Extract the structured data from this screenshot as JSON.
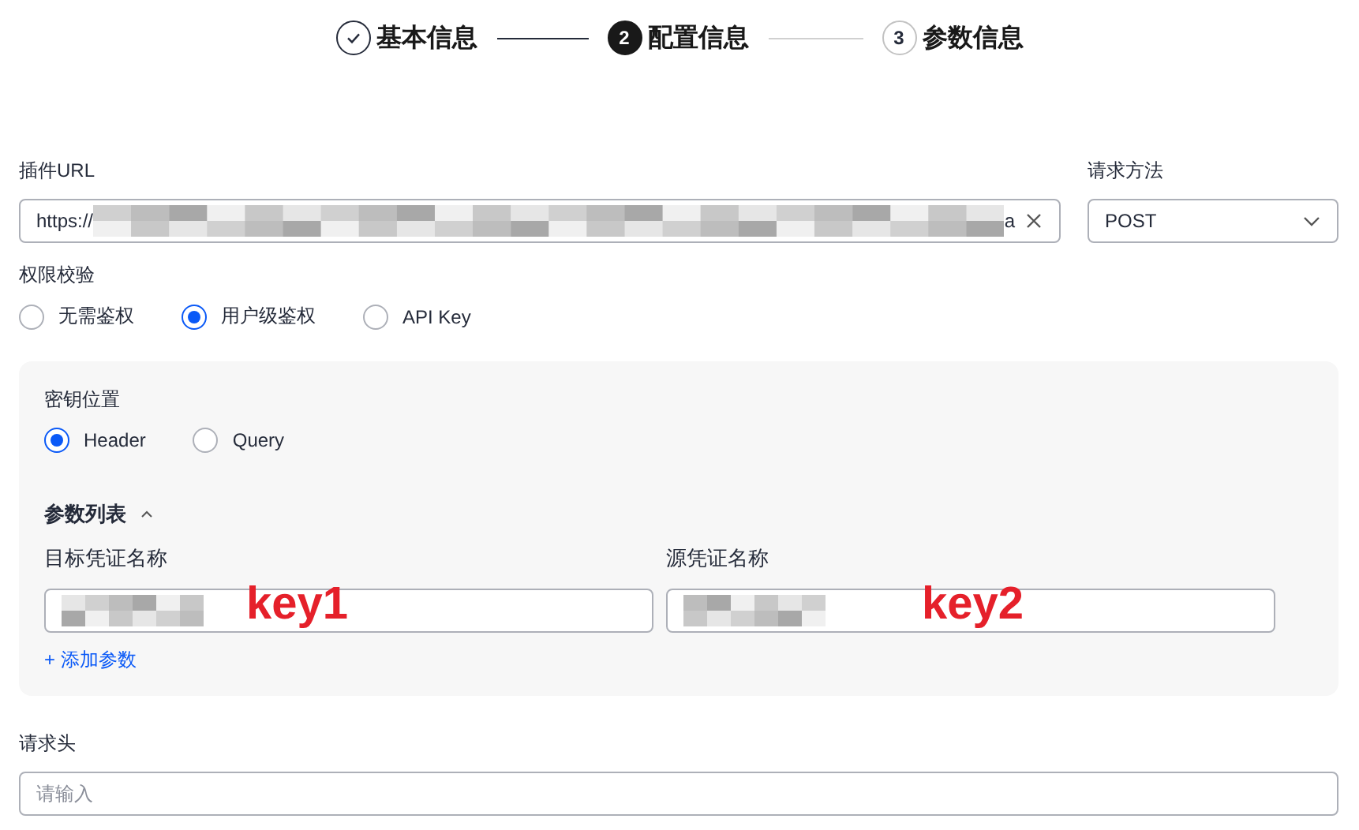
{
  "steps": [
    {
      "label": "基本信息",
      "completed": true,
      "selected": false
    },
    {
      "number": "2",
      "label": "配置信息",
      "completed": false,
      "selected": true
    },
    {
      "number": "3",
      "label": "参数信息",
      "completed": false,
      "selected": false
    }
  ],
  "url_field": {
    "label": "插件URL",
    "value_start": "https://",
    "value_end": "a"
  },
  "method_field": {
    "label": "请求方法",
    "value": "POST"
  },
  "auth": {
    "label": "权限校验",
    "options": [
      {
        "label": "无需鉴权",
        "selected": false
      },
      {
        "label": "用户级鉴权",
        "selected": true
      },
      {
        "label": "API Key",
        "selected": false
      }
    ]
  },
  "key_location": {
    "label": "密钥位置",
    "options": [
      {
        "label": "Header",
        "selected": true
      },
      {
        "label": "Query",
        "selected": false
      }
    ]
  },
  "params": {
    "title": "参数列表",
    "expanded": true,
    "columns": [
      {
        "label": "目标凭证名称",
        "annotation": "key1"
      },
      {
        "label": "源凭证名称",
        "annotation": "key2"
      }
    ],
    "add_link": "+ 添加参数"
  },
  "headers_field": {
    "label": "请求头",
    "placeholder": "请输入"
  }
}
